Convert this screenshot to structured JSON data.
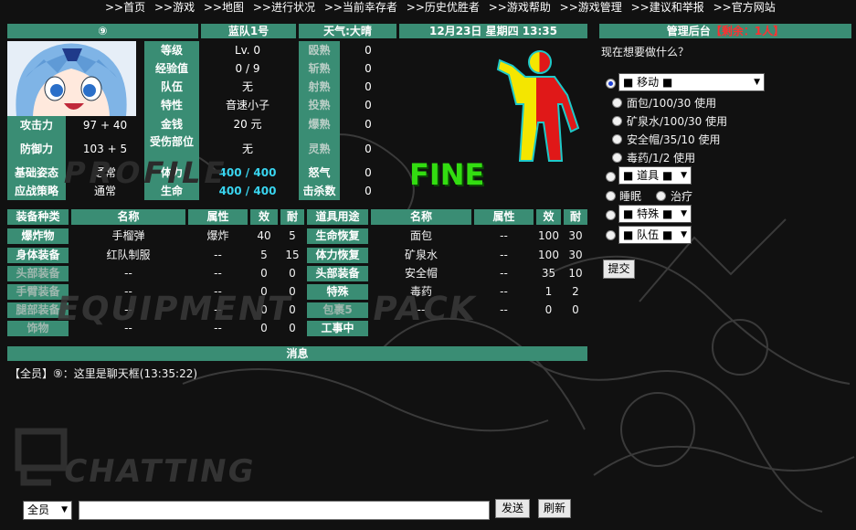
{
  "nav": {
    "items": [
      ">>首页",
      ">>游戏",
      ">>地图",
      ">>进行状况",
      ">>当前幸存者",
      ">>历史优胜者",
      ">>游戏帮助",
      ">>游戏管理",
      ">>建议和举报",
      ">>官方网站"
    ]
  },
  "header": {
    "player_badge": "⑨",
    "team": "蓝队1号",
    "weather": "天气:大晴",
    "datetime": "12月23日 星期四 13:35",
    "admin_title": "管理后台",
    "survivors_prefix": "【",
    "survivors": "剩余：1人",
    "survivors_suffix": "】"
  },
  "stats": {
    "level_label": "等级",
    "level_value": "Lv. 0",
    "exp_label": "经验值",
    "exp_value": "0 / 9",
    "team_label": "队伍",
    "team_value": "无",
    "trait_label": "特性",
    "trait_value": "音速小子",
    "money_label": "金钱",
    "money_value": "20 元",
    "injury_label": "受伤部位",
    "injury_value": "无",
    "stamina_label": "体力",
    "stamina_value": "400 / 400",
    "life_label": "生命",
    "life_value": "400 / 400",
    "attack_label": "攻击力",
    "attack_value": "97 + 40",
    "defense_label": "防御力",
    "defense_value": "103 + 5",
    "stance_label": "基础姿态",
    "stance_value": "通常",
    "strategy_label": "应战策略",
    "strategy_value": "通常"
  },
  "skills": [
    {
      "label": "殴熟",
      "value": "0"
    },
    {
      "label": "斩熟",
      "value": "0"
    },
    {
      "label": "射熟",
      "value": "0"
    },
    {
      "label": "投熟",
      "value": "0"
    },
    {
      "label": "爆熟",
      "value": "0"
    },
    {
      "label": "灵熟",
      "value": "0"
    },
    {
      "label": "怒气",
      "value": "0"
    },
    {
      "label": "击杀数",
      "value": "0"
    }
  ],
  "status_word": "FINE",
  "equipment": {
    "headers": [
      "装备种类",
      "名称",
      "属性",
      "效",
      "耐"
    ],
    "rows": [
      {
        "slot": "爆炸物",
        "name": "手榴弹",
        "attr": "爆炸",
        "eff": "40",
        "dur": "5"
      },
      {
        "slot": "身体装备",
        "name": "红队制服",
        "attr": "--",
        "eff": "5",
        "dur": "15"
      },
      {
        "slot": "头部装备",
        "name": "--",
        "attr": "--",
        "eff": "0",
        "dur": "0"
      },
      {
        "slot": "手臂装备",
        "name": "--",
        "attr": "--",
        "eff": "0",
        "dur": "0"
      },
      {
        "slot": "腿部装备",
        "name": "--",
        "attr": "--",
        "eff": "0",
        "dur": "0"
      },
      {
        "slot": "饰物",
        "name": "--",
        "attr": "--",
        "eff": "0",
        "dur": "0"
      }
    ]
  },
  "items": {
    "headers": [
      "道具用途",
      "名称",
      "属性",
      "效",
      "耐"
    ],
    "rows": [
      {
        "use": "生命恢复",
        "name": "面包",
        "attr": "--",
        "eff": "100",
        "dur": "30"
      },
      {
        "use": "体力恢复",
        "name": "矿泉水",
        "attr": "--",
        "eff": "100",
        "dur": "30"
      },
      {
        "use": "头部装备",
        "name": "安全帽",
        "attr": "--",
        "eff": "35",
        "dur": "10"
      },
      {
        "use": "特殊",
        "name": "毒药",
        "attr": "--",
        "eff": "1",
        "dur": "2"
      },
      {
        "use": "包裹5",
        "name": "--",
        "attr": "--",
        "eff": "0",
        "dur": "0"
      },
      {
        "use": "工事中",
        "name": "",
        "attr": "",
        "eff": "",
        "dur": ""
      }
    ]
  },
  "watermarks": {
    "profile": "PROFILE",
    "equipment": "EQUIPMENT",
    "pack": "PACK",
    "chatting": "CHATTING"
  },
  "messages": {
    "header": "消息",
    "lines": [
      "【全员】⑨：这里是聊天框(13:35:22)"
    ]
  },
  "chat": {
    "channel": "全员",
    "send": "发送",
    "refresh": "刷新"
  },
  "actions": {
    "prompt": "现在想要做什么？",
    "move_select": "■ 移动 ■",
    "use_items": [
      "面包/100/30 使用",
      "矿泉水/100/30 使用",
      "安全帽/35/10 使用",
      "毒药/1/2 使用"
    ],
    "item_select": "■ 道具 ■",
    "sleep": "睡眠",
    "heal": "治疗",
    "special_select": "■ 特殊 ■",
    "team_select": "■ 队伍 ■",
    "submit": "提交"
  },
  "colors": {
    "header_bg": "#3a8d74",
    "accent_cyan": "#39d5f0",
    "danger_red": "#ff3030",
    "status_green": "#33dd11"
  }
}
